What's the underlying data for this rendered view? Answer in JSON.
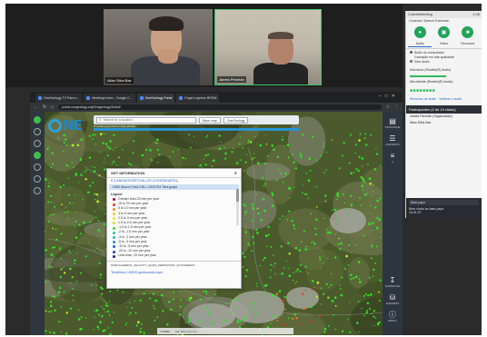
{
  "video": {
    "participant1_name": "Allan Silva Baz",
    "participant2_name": "James Penman"
  },
  "teams_panel": {
    "top_title": "CobbleMeeting",
    "top_time": "1:06",
    "subtitle": "Conectar: Speech Extension",
    "controls": [
      "mic-icon",
      "screen-icon",
      "camera-icon"
    ],
    "tabs": [
      "Áudio",
      "Vídeo",
      "Recursos"
    ],
    "audio_label": "Áudio do computador",
    "option1": "Gravação em alta qualidade",
    "option2": "Sem áudio",
    "device1": "Microfone (Realtek(R) Audio)",
    "device2": "Alto-falante (Realtek(R) Audio)",
    "link1": "Recursos de áudio",
    "link2": "Verificar o áudio",
    "participants_title": "Participantes (2 de 10 vistos)",
    "part1": "James Penman (Organizador)",
    "part2": "Allan Silva Baz",
    "chat_title": "Bate-papo",
    "chat_msg": "Bem-vindo ao bate-papo",
    "chat_time": "16:01:27"
  },
  "browser": {
    "tabs": [
      "OneGeology TV Para o...",
      "Meetings index - Google C...",
      "OneGeology Portal",
      "Engel Lugreine BRGM"
    ],
    "url": "portal.onegeology.org/OnegeologyGlobal/"
  },
  "app": {
    "logo": "NE",
    "search_placeholder": "Search for a location",
    "basemap_label": "Base map",
    "view_label": "OneGeology",
    "sub_text": "Providing geoscience data globally",
    "right_tools": [
      {
        "icon": "catalog-icon",
        "label": "CATALOGUE"
      },
      {
        "icon": "layers-icon",
        "label": "CONTENTS"
      },
      {
        "icon": "text-icon",
        "label": "A"
      },
      {
        "icon": "download-icon",
        "label": "DOWNLOAD"
      },
      {
        "icon": "database-icon",
        "label": "DATASETS"
      },
      {
        "icon": "info-icon",
        "label": "ABOUT"
      }
    ]
  },
  "popup": {
    "title": "GET INFORMATION",
    "tabs_text": "E (LANDSAT/VERTICAL) BY (COORDINATES)",
    "highlight": "GMS Slow in Fast GGL / GGS Pt4 Tiles graph",
    "legend_title": "Legend",
    "legend": [
      {
        "label": "Greater than 20 mm per year",
        "color": "#b0001c"
      },
      {
        "label": "15 to 20 mm per year",
        "color": "#e8341c"
      },
      {
        "label": "5 to 10 mm per year",
        "color": "#f08a1c"
      },
      {
        "label": "3 to 5 mm per year",
        "color": "#f5c41c"
      },
      {
        "label": "2.5 to 3 mm per year",
        "color": "#f5e41c"
      },
      {
        "label": "1.5 to 2.5 mm per year",
        "color": "#cfe81c"
      },
      {
        "label": "-1.5 to 1.5 mm per year",
        "color": "#3fd435"
      },
      {
        "label": "-2 to -1.5 mm per year",
        "color": "#1ccf9a"
      },
      {
        "label": "-3 to -2 mm per year",
        "color": "#1cb8d8"
      },
      {
        "label": "-5 to -3 mm per year",
        "color": "#1c8ae8"
      },
      {
        "label": "-10 to -5 mm per year",
        "color": "#1c5ae8"
      },
      {
        "label": "-20 to -10 mm per year",
        "color": "#2a32c8"
      },
      {
        "label": "Less than -20 mm per year",
        "color": "#1c1c8a"
      }
    ],
    "footer": "DISPLACEMENT_VELOCITY_EGMS_PERSISTENT_SCATTERERS",
    "footer_link": "Terrafirma 1:50000 geohazards layer"
  },
  "status": {
    "scale": "1:50000",
    "coords": "Lat: 43.1 Lon: 1.4"
  }
}
